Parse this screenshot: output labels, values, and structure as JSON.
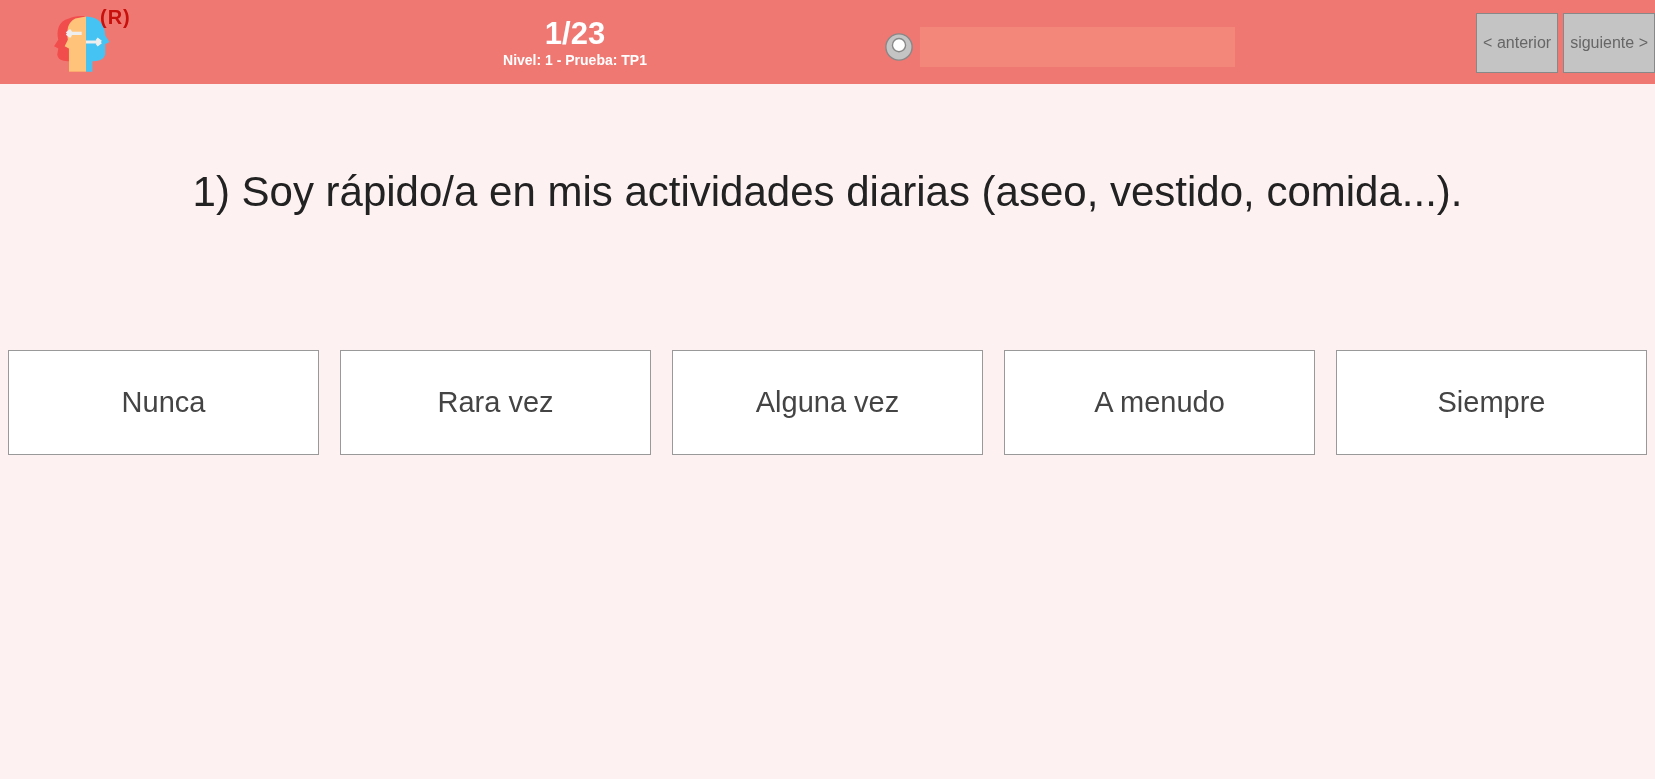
{
  "header": {
    "logo_mark": "(R)",
    "progress": "1/23",
    "subtitle": "Nivel: 1 - Prueba: TP1",
    "nav_buttons": [
      "< anterior",
      "siguiente >"
    ]
  },
  "question": "1) Soy rápido/a en mis actividades diarias (aseo, vestido, comida...).",
  "options": [
    {
      "label": "Nunca",
      "selected": false
    },
    {
      "label": "Rara vez",
      "selected": false
    },
    {
      "label": "Alguna vez",
      "selected": false
    },
    {
      "label": "A menudo",
      "selected": false
    },
    {
      "label": "Siempre",
      "selected": false
    }
  ]
}
